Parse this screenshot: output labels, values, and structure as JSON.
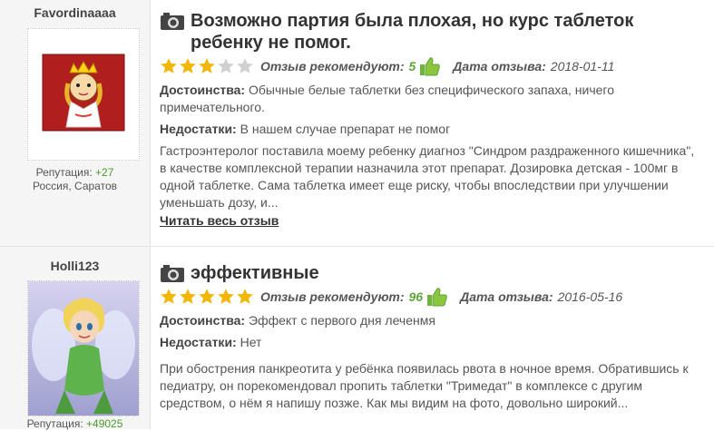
{
  "reviews": [
    {
      "username": "Favordinaaaa",
      "avatar_icon": "princess-cartoon-avatar",
      "reputation_label": "Репутация:",
      "reputation_value": "+27",
      "location": "Россия, Саратов",
      "title": "Возможно партия была плохая, но курс таблеток ребенку не помог.",
      "rating": 3,
      "rating_max": 5,
      "recommend_label": "Отзыв рекомендуют:",
      "recommend_count": "5",
      "date_label": "Дата отзыва:",
      "date": "2018-01-11",
      "pros_label": "Достоинства:",
      "pros": "Обычные белые таблетки без специфического запаха, ничего примечательного.",
      "cons_label": "Недостатки:",
      "cons": "В нашем случае препарат не помог",
      "text": "Гастроэнтеролог поставила моему ребенку диагноз \"Синдром раздраженного кишечника\", в качестве комплексной терапии назначила этот препарат. Дозировка детская - 100мг в одной таблетке. Сама таблетка имеет еще риску, чтобы впоследствии при улучшении уменьшать дозу, и...",
      "read_more": "Читать весь отзыв"
    },
    {
      "username": "Holli123",
      "avatar_icon": "tinkerbell-fairy-avatar",
      "reputation_label": "Репутация:",
      "reputation_value": "+49025",
      "title": "эффективные",
      "rating": 5,
      "rating_max": 5,
      "recommend_label": "Отзыв рекомендуют:",
      "recommend_count": "96",
      "date_label": "Дата отзыва:",
      "date": "2016-05-16",
      "pros_label": "Достоинства:",
      "pros": "Эффект с первого дня леченмя",
      "cons_label": "Недостатки:",
      "cons": "Нет",
      "text": "При обострения панкреотита у ребёнка появилась рвота в ночное время. Обратившись к педиатру, он порекомендовал пропить таблетки \"Тримедат\" в комплексе с другим средством, о нём я напишу позже. Как мы видим на фото, довольно широкий..."
    }
  ],
  "colors": {
    "star_on": "#f2b705",
    "star_off": "#d0d0d0",
    "accent_green": "#5fa33a"
  }
}
